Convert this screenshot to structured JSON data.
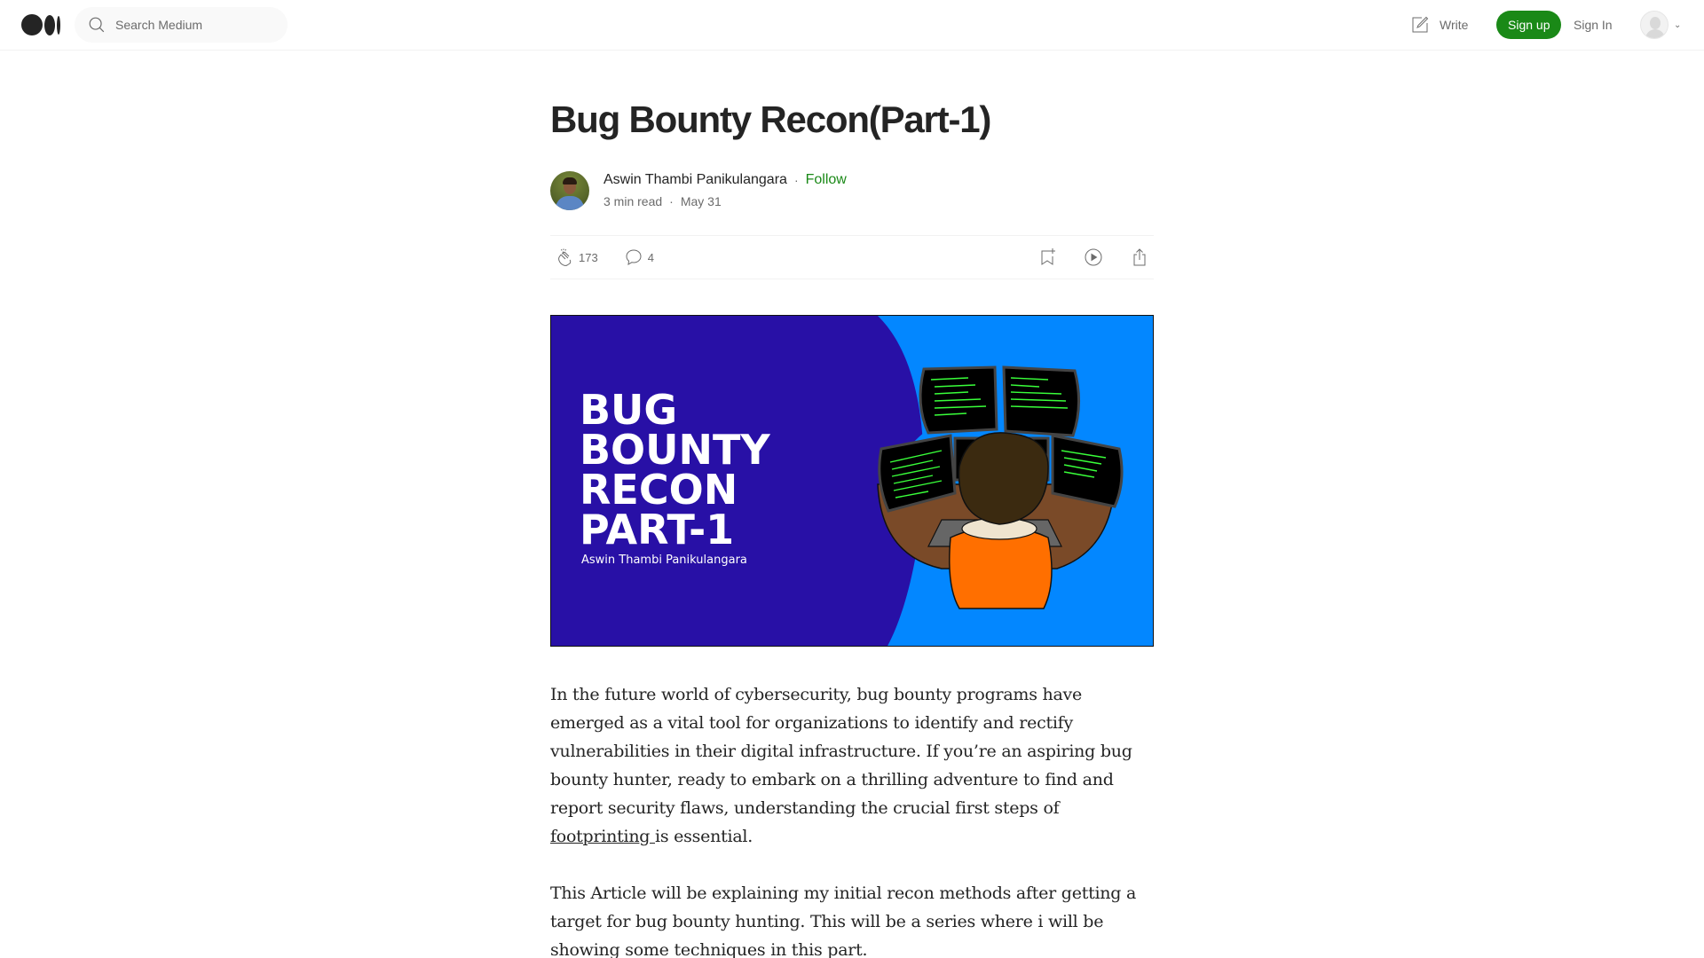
{
  "header": {
    "logo": "medium-logo",
    "search_placeholder": "Search Medium",
    "write_label": "Write",
    "signup_label": "Sign up",
    "signin_label": "Sign In",
    "brand_color": "#1a8917"
  },
  "article": {
    "title": "Bug Bounty Recon(Part-1)",
    "author": "Aswin Thambi Panikulangara",
    "follow_label": "Follow",
    "separator": "·",
    "read_time": "3 min read",
    "date": "May 31",
    "claps": "173",
    "responses": "4",
    "hero": {
      "lines": [
        "BUG",
        "BOUNTY",
        "RECON",
        "PART-1"
      ],
      "author": "Aswin Thambi Panikulangara",
      "colors": {
        "left": "#2810a6",
        "right": "#0387ff"
      }
    },
    "paragraphs": [
      {
        "before": "In the future world of cybersecurity, bug bounty programs have emerged as a vital tool for organizations to identify and rectify vulnerabilities in their digital infrastructure. If you’re an aspiring bug bounty hunter, ready to embark on a thrilling adventure to find and report security flaws, understanding the crucial first steps of ",
        "link": "footprinting ",
        "after": "is essential."
      },
      {
        "text": "This Article will be explaining my initial recon methods after getting a target for bug bounty hunting. This will be a series where i will be showing some techniques in this part."
      }
    ]
  }
}
